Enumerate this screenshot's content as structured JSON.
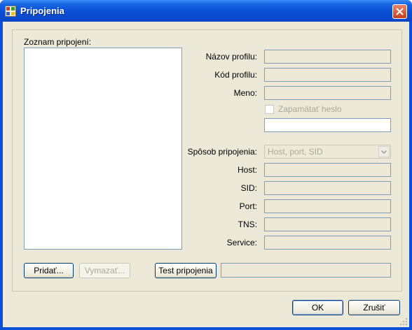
{
  "window": {
    "title": "Pripojenia"
  },
  "panel": {
    "list_label": "Zoznam pripojení:",
    "profile_name_label": "Názov profilu:",
    "profile_code_label": "Kód profilu:",
    "username_label": "Meno:",
    "remember_password_label": "Zapamätať heslo",
    "connection_method_label": "Spôsob pripojenia:",
    "connection_method_value": "Host, port, SID",
    "host_label": "Host:",
    "sid_label": "SID:",
    "port_label": "Port:",
    "tns_label": "TNS:",
    "service_label": "Service:",
    "add_button": "Pridať...",
    "delete_button": "Vymazať...",
    "test_button": "Test pripojenia"
  },
  "footer": {
    "ok_button": "OK",
    "cancel_button": "Zrušiť"
  },
  "colors": {
    "titlebar": "#0b4fd6",
    "dialog_bg": "#ece9d8",
    "field_border": "#7f9db9",
    "disabled_text": "#aca899"
  }
}
